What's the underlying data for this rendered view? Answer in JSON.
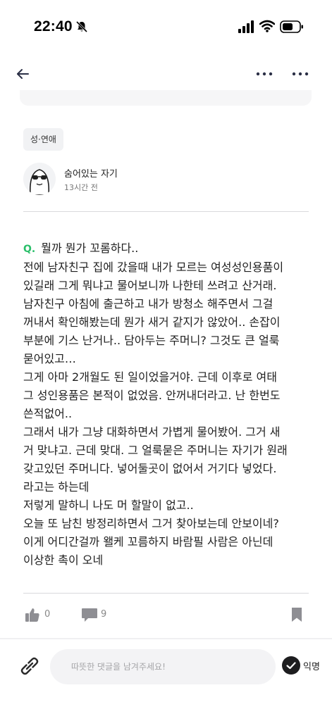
{
  "status_bar": {
    "time": "22:40"
  },
  "icons": {
    "bell_off": "bell-slash-icon",
    "signal": "cellular-signal-icon",
    "wifi": "wifi-icon",
    "battery": "battery-icon",
    "back": "arrow-left-icon",
    "more": "ellipsis-icon",
    "like": "thumbs-up-icon",
    "comment": "speech-bubble-icon",
    "bookmark": "bookmark-icon",
    "attach": "paperclip-icon",
    "anon_check": "checkmark-circle-icon"
  },
  "post": {
    "category": "성·연애",
    "author": "숨어있는 자기",
    "time_ago": "13시간 전",
    "q_label": "Q.",
    "body": "뭘까 뭔가 꼬롬하다..\n전에 남자친구 집에 갔을때 내가 모르는 여성성인용품이\n있길래 그게 뭐냐고 물어보니까 나한테 쓰려고 산거래.\n남자친구 아침에 출근하고 내가 방청소 해주면서 그걸\n꺼내서 확인해봤는데 뭔가 새거 같지가 않았어.. 손잡이\n부분에 기스 난거나.. 담아두는 주머니? 그것도 큰 얼룩\n묻어있고…\n그게 아마 2개월도 된 일이었을거야. 근데 이후로 여태\n그 성인용품은 본적이 없었음. 안꺼내더라고. 난 한번도\n쓴적없어..\n그래서 내가 그냥 대화하면서 가볍게 물어봤어. 그거 새\n거 맞냐고. 근데 맞대. 그 얼룩묻은 주머니는 자기가 원래\n갖고있던 주머니다. 넣어둘곳이 없어서 거기다 넣었다.\n라고는 하는데\n저렇게 말하니 나도 머 할말이 없고..\n오늘 또 남친 방정리하면서 그거 찾아보는데 안보이네?\n이게 어디간걸까 왤케 꼬름하지 바람필 사람은 아닌데\n이상한 촉이 오네",
    "like_count": "0",
    "comment_count": "9"
  },
  "comment_bar": {
    "placeholder": "따뜻한 댓글을 남겨주세요!",
    "anon_label": "익명"
  },
  "colors": {
    "accent_green": "#2bbf6a",
    "text_primary": "#1f1f1f",
    "icon_gray": "#8e8e93",
    "divider": "#d9d9dc"
  }
}
